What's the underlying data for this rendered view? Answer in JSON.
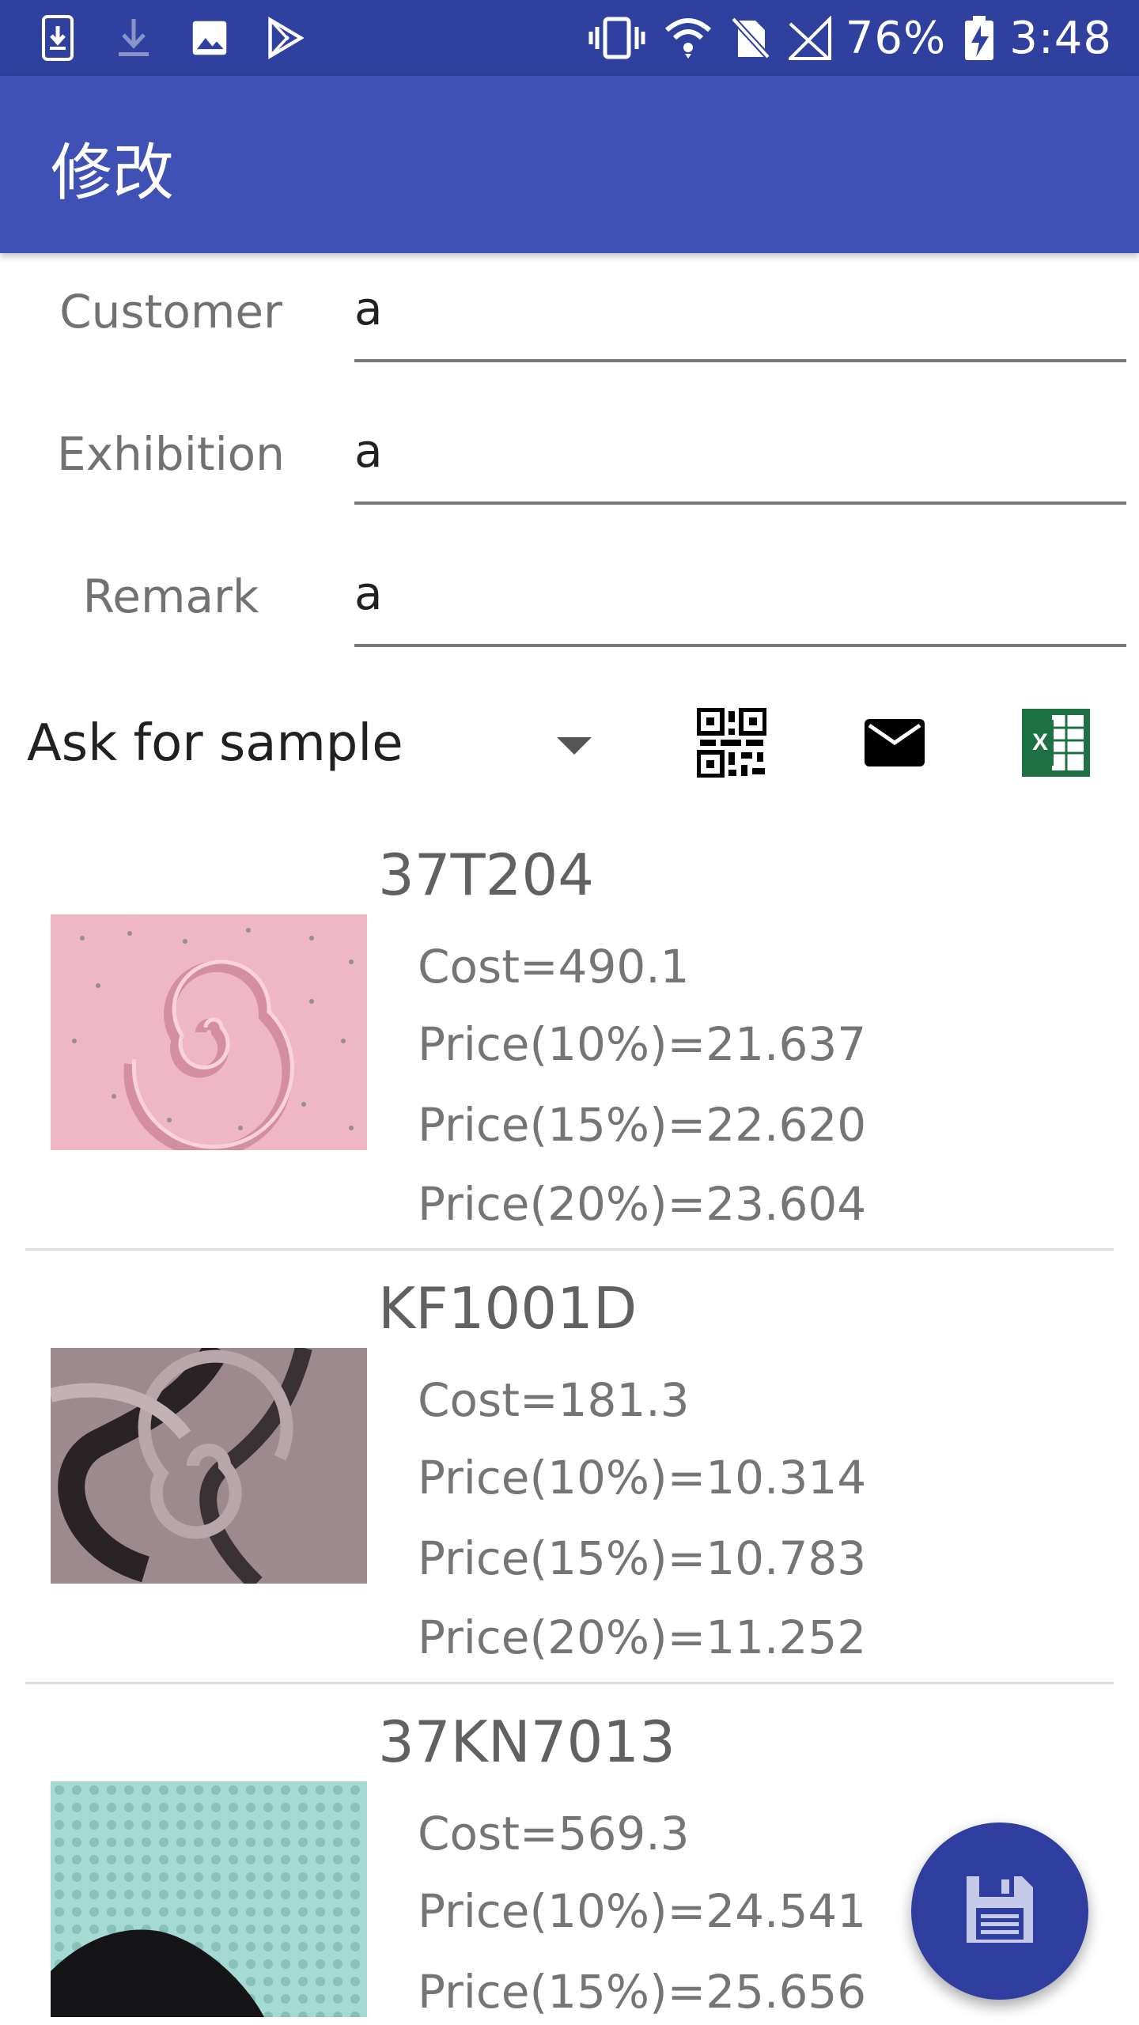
{
  "status_bar": {
    "battery": "76%",
    "time": "3:48"
  },
  "app_bar": {
    "title": "修改"
  },
  "form": {
    "customer_label": "Customer",
    "customer_value": "a",
    "exhibition_label": "Exhibition",
    "exhibition_value": "a",
    "remark_label": "Remark",
    "remark_value": "a"
  },
  "controls": {
    "spinner_value": "Ask for sample",
    "icons": [
      "qr-code-icon",
      "mail-icon",
      "excel-icon"
    ]
  },
  "items": [
    {
      "code": "37T204",
      "cost": "Cost=490.1",
      "price10": "Price(10%)=21.637",
      "price15": "Price(15%)=22.620",
      "price20": "Price(20%)=23.604",
      "swatch_color": "#f0b8c8"
    },
    {
      "code": "KF1001D",
      "cost": "Cost=181.3",
      "price10": "Price(10%)=10.314",
      "price15": "Price(15%)=10.783",
      "price20": "Price(20%)=11.252",
      "swatch_color": "#9c8a8e"
    },
    {
      "code": "37KN7013",
      "cost": "Cost=569.3",
      "price10": "Price(10%)=24.541",
      "price15": "Price(15%)=25.656",
      "swatch_color": "#9ed4cc"
    }
  ],
  "colors": {
    "status_bar": "#30409f",
    "app_bar": "#3f51b5",
    "fab": "#303f9f",
    "excel_green": "#1e7145"
  }
}
